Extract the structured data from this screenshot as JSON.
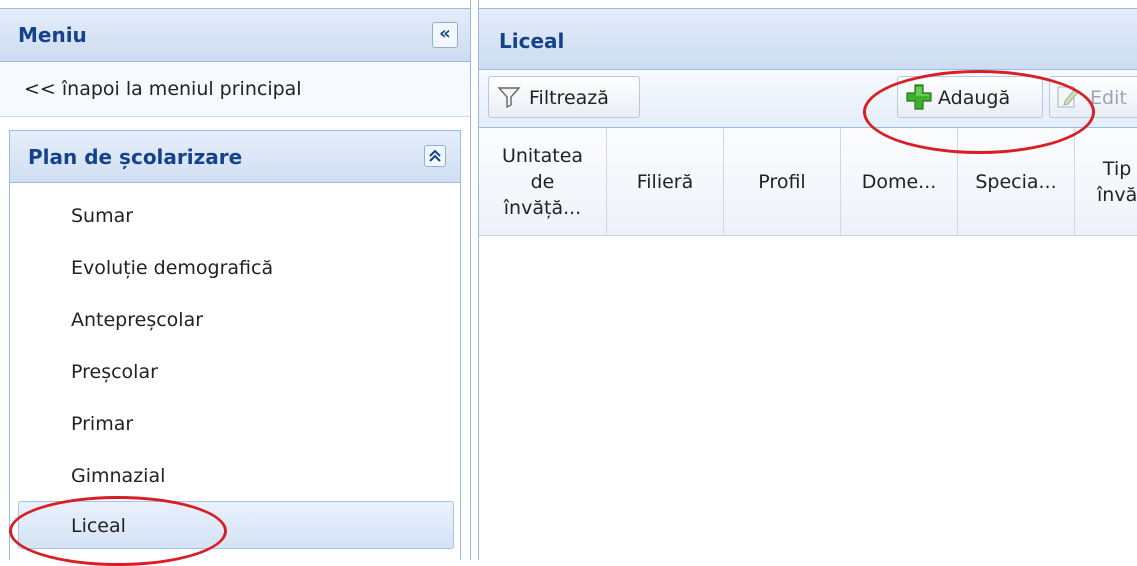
{
  "sidebar": {
    "title": "Meniu",
    "collapse_glyph": "«",
    "back_link": "<< înapoi la meniul principal",
    "section": {
      "title": "Plan de școlarizare",
      "toggle_glyph": "⌃⌃",
      "items": [
        {
          "label": "Sumar"
        },
        {
          "label": "Evoluție demografică"
        },
        {
          "label": "Antepreșcolar"
        },
        {
          "label": "Preșcolar"
        },
        {
          "label": "Primar"
        },
        {
          "label": "Gimnazial"
        },
        {
          "label": "Liceal",
          "selected": true
        }
      ]
    }
  },
  "main": {
    "title": "Liceal",
    "toolbar": {
      "filter_label": "Filtrează",
      "add_label": "Adaugă",
      "edit_label": "Edit"
    },
    "grid": {
      "columns": [
        "Unitatea\nde\nînvăță...",
        "Filieră",
        "Profil",
        "Dome...",
        "Specia...",
        "Tip\nînvă"
      ]
    }
  },
  "colors": {
    "header_text": "#15428b",
    "border": "#99bbe8",
    "annotation": "#d81f26",
    "add_icon": "#3fae2a"
  }
}
